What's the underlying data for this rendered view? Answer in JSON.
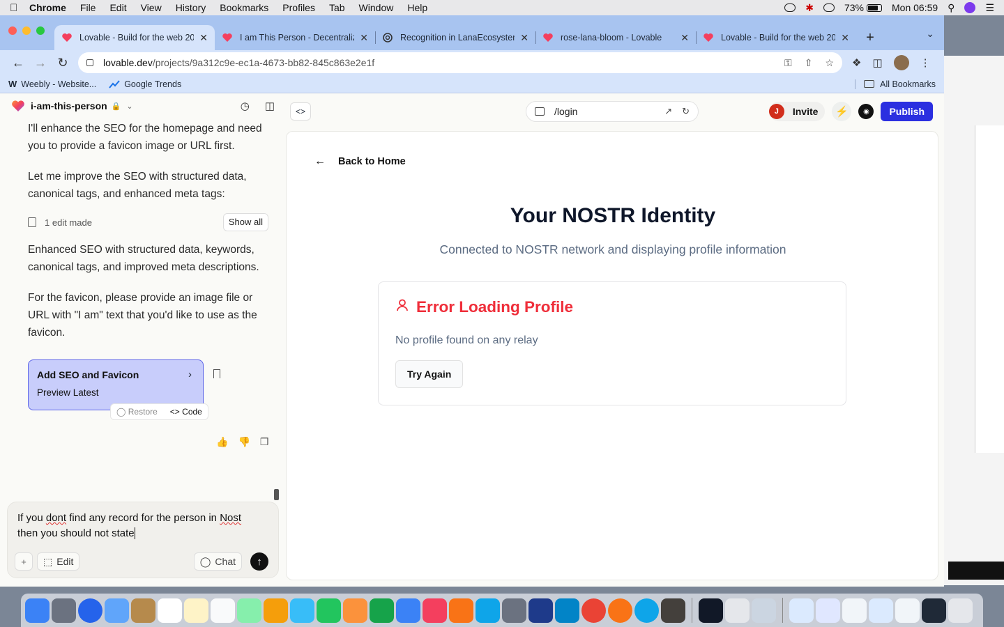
{
  "menubar": {
    "app": "Chrome",
    "items": [
      "File",
      "Edit",
      "View",
      "History",
      "Bookmarks",
      "Profiles",
      "Tab",
      "Window",
      "Help"
    ],
    "battery": "73%",
    "clock": "Mon 06:59"
  },
  "browser": {
    "tabs": [
      {
        "title": "Lovable - Build for the web 20",
        "color": "#f472b6"
      },
      {
        "title": "I am This Person - Decentraliz",
        "color": "#f472b6"
      },
      {
        "title": "Recognition in LanaEcosystem",
        "color": "#555555"
      },
      {
        "title": "rose-lana-bloom - Lovable",
        "color": "#f472b6"
      },
      {
        "title": "Lovable - Build for the web 20",
        "color": "#f472b6"
      }
    ],
    "url_domain": "lovable.dev",
    "url_path": "/projects/9a312c9e-ec1a-4673-bb82-845c863e2e1f",
    "bookmarks": [
      "Weebly - Website...",
      "Google Trends"
    ],
    "all_bookmarks": "All Bookmarks"
  },
  "project": {
    "name": "i-am-this-person"
  },
  "chat": {
    "messages": [
      "I'll enhance the SEO for the homepage and need you to provide a favicon image or URL first.",
      "Let me improve the SEO with structured data, canonical tags, and enhanced meta tags:",
      "Enhanced SEO with structured data, keywords, canonical tags, and improved meta descriptions.",
      "For the favicon, please provide an image file or URL with \"I am\" text that you'd like to use as the favicon."
    ],
    "edit_count": "1 edit made",
    "show_all": "Show all",
    "card_title": "Add SEO and Favicon",
    "card_sub": "Preview Latest",
    "restore": "Restore",
    "code": "Code"
  },
  "input": {
    "text_before": "If you ",
    "misspelled_1": "dont",
    "text_mid": " find any record for the person in ",
    "misspelled_2": "Nost",
    "text_after": " then you should not state ",
    "edit_label": "Edit",
    "chat_label": "Chat"
  },
  "preview": {
    "route": "/login",
    "invite": "Invite",
    "invite_initial": "J",
    "publish": "Publish",
    "back": "Back to Home",
    "title": "Your NOSTR Identity",
    "subtitle": "Connected to NOSTR network and displaying profile information",
    "error_title": "Error Loading Profile",
    "error_msg": "No profile found on any relay",
    "try_again": "Try Again"
  },
  "colors": {
    "publish": "#2b2fe0",
    "error": "#ef2e3a",
    "card_bg": "#c8cdfb",
    "card_border": "#5b63e8"
  }
}
